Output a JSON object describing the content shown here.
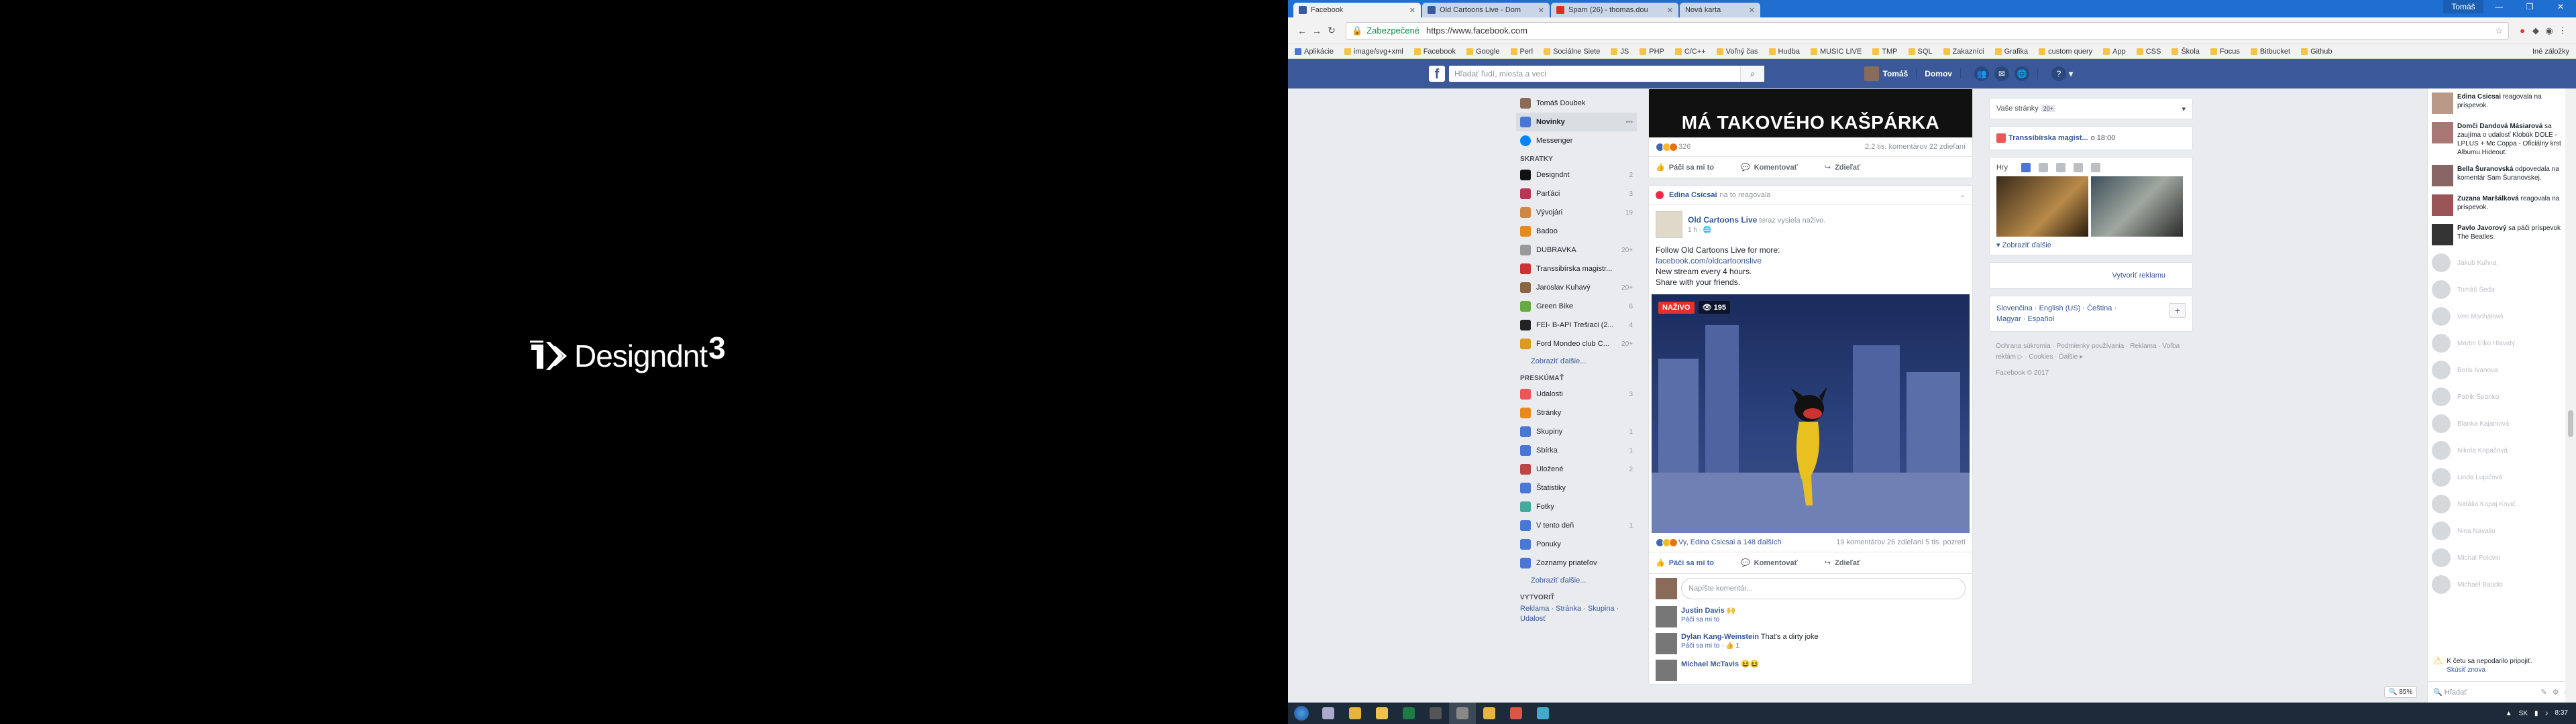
{
  "logo": {
    "brand": "Designdnt",
    "suffix": "3"
  },
  "browser": {
    "tabs": [
      {
        "title": "Facebook",
        "color": "#3b5998",
        "active": true
      },
      {
        "title": "Old Cartoons Live - Dom",
        "color": "#3b5998",
        "active": false
      },
      {
        "title": "Spam (26) - thomas.dou",
        "color": "#d93025",
        "active": false
      },
      {
        "title": "Nová karta",
        "color": "#cccccc",
        "active": false
      }
    ],
    "window_controls": [
      "Tomáš",
      "—",
      "❐",
      "✕"
    ],
    "secure_label": "Zabezpečené",
    "url": "https://www.facebook.com",
    "bookmarks": [
      "Aplikácie",
      "image/svg+xml",
      "Facebook",
      "Google",
      "Perl",
      "Sociálne Siete",
      "JS",
      "PHP",
      "C/C++",
      "Voľný čas",
      "Hudba",
      "MUSIC LIVE",
      "TMP",
      "SQL",
      "Zakazníci",
      "Grafika",
      "custom query",
      "App",
      "CSS",
      "Škola",
      "Focus",
      "Bitbucket",
      "Github"
    ],
    "other_bookmarks": "Iné záložky"
  },
  "fb": {
    "search_placeholder": "Hľadať ľudí, miesta a veci",
    "user": "Tomáš",
    "home": "Domov",
    "nav": {
      "profile": "Tomáš Doubek",
      "primary": [
        {
          "label": "Novinky",
          "active": true
        },
        {
          "label": "Messenger"
        }
      ],
      "shortcuts_header": "SKRATKY",
      "shortcuts": [
        {
          "label": "Designdnt",
          "count": "2",
          "color": "#111"
        },
        {
          "label": "Parťáci",
          "count": "3",
          "color": "#b35"
        },
        {
          "label": "Vývojári",
          "count": "19",
          "color": "#c84"
        },
        {
          "label": "Badoo",
          "count": "",
          "color": "#e8891e"
        },
        {
          "label": "DUBRAVKA",
          "count": "20+",
          "color": "#999"
        },
        {
          "label": "Transsibírska magistr...",
          "count": "",
          "color": "#c33"
        },
        {
          "label": "Jaroslav Kuhavý",
          "count": "20+",
          "color": "#864"
        },
        {
          "label": "Green Bike",
          "count": "6",
          "color": "#6a4"
        },
        {
          "label": "FEI- B-API Trešiaci (2...",
          "count": "4",
          "color": "#222"
        },
        {
          "label": "Ford Mondeo club C...",
          "count": "20+",
          "color": "#d92"
        }
      ],
      "show_more": "Zobraziť ďalšie...",
      "explore_header": "PRESKÚMAŤ",
      "explore": [
        {
          "label": "Udalosti",
          "count": "3",
          "color": "#e55"
        },
        {
          "label": "Stránky",
          "count": "",
          "color": "#e8891e"
        },
        {
          "label": "Skupiny",
          "count": "1",
          "color": "#4a76d4"
        },
        {
          "label": "Sbírka",
          "count": "1",
          "color": "#4a76d4"
        },
        {
          "label": "Uložené",
          "count": "2",
          "color": "#b44"
        },
        {
          "label": "Štatistiky",
          "count": "",
          "color": "#4a76d4"
        },
        {
          "label": "Fotky",
          "count": "",
          "color": "#4a9"
        },
        {
          "label": "V tento deň",
          "count": "1",
          "color": "#4a76d4"
        },
        {
          "label": "Ponuky",
          "count": "",
          "color": "#4a76d4"
        },
        {
          "label": "Zoznamy priateľov",
          "count": "",
          "color": "#4a76d4"
        }
      ],
      "show_more2": "Zobraziť ďalšie...",
      "create_header": "VYTVORIŤ",
      "create_links": "Reklama · Stránka · Skupina · Udalosť"
    },
    "post1": {
      "banner": "MÁ TAKOVÉHO KAŠPÁRKA",
      "reactions": "326",
      "comments_shares": "2,2 tis. komentárov  22 zdieľaní",
      "actions": [
        "Páči sa mi to",
        "Komentovať",
        "Zdieľať"
      ]
    },
    "post2": {
      "notice_name": "Edina Csicsai",
      "notice_text": "na to reagovala",
      "page": "Old Cartoons Live",
      "page_sub": "teraz vysiela naživo.",
      "time": "1 h · 🌐",
      "lines": [
        "Follow Old Cartoons Live for more:",
        "facebook.com/oldcartoonslive",
        "New stream every 4 hours.",
        "Share with your friends."
      ],
      "live_label": "NAŽIVO",
      "viewers": "195",
      "reactions": "Vy, Edina Csicsai a 148 ďalších",
      "comments_shares": "19 komentárov  26 zdieľaní  5 tis. pozretí",
      "actions": [
        "Páči sa mi to",
        "Komentovať",
        "Zdieľať"
      ],
      "comment_placeholder": "Napíšte komentár...",
      "comments": [
        {
          "name": "Justin Davis",
          "text": "🙌",
          "meta": "Páči sa mi to"
        },
        {
          "name": "Dylan Kang-Weinstein",
          "text": "That's a dirty joke",
          "meta": "Páči sa mi to · 👍 1"
        },
        {
          "name": "Michael McTavis",
          "text": "😆😆",
          "meta": ""
        }
      ]
    },
    "right": {
      "pages_select": "Vaše stránky",
      "pages_badge": "20+",
      "event_name": "Transsibírska magist...",
      "event_time": "o 18:00",
      "games_title": "Hry",
      "games_more": "Zobraziť ďalšie",
      "ads": "Vytvoriť reklamu",
      "languages": "Slovenčina · English (US) · Čeština · Magyar · Español",
      "footer1": "Ochrana súkromia · Podmienky používania · Reklama · Voľba reklám ▷ · Cookies · Ďalšie ▸",
      "footer2": "Facebook © 2017"
    },
    "chat": {
      "notifications": [
        {
          "name": "Edina Csicsai",
          "text": "reagovala na príspevok.",
          "color": "#b98"
        },
        {
          "name": "Domči Dandová Másiarová",
          "text": "sa zaujíma o udalosť Klobúk DOLE - LPLUS + Mc Coppa - Oficiálny krst Albumu Hideout.",
          "color": "#a77"
        },
        {
          "name": "Bella Šuranovská",
          "text": "odpovedala na komentár Sam Šuranovskej.",
          "color": "#866"
        },
        {
          "name": "Zuzana Maršálková",
          "text": "reagovala na príspevok.",
          "color": "#955"
        },
        {
          "name": "Pavlo Javorový",
          "text": "sa páči príspevok The Beatles.",
          "color": "#333"
        }
      ],
      "contacts": [
        "Jakub Kuhna",
        "Tomáš Šeda",
        "Veri Machálová",
        "Martin Elko Hlavatý",
        "Boris Ivanova",
        "Patrik Španko",
        "Blanka Kajaniová",
        "Nikola Kopačová",
        "Linda Lupičová",
        "Natália Kopaj Kovič",
        "Nina Navalio",
        "Michal Polovin",
        "Michael Baudis"
      ],
      "offline_text": "K četu sa nepodarilo pripojiť.",
      "offline_retry": "Skúsiť znova",
      "search_placeholder": "Hľadať"
    },
    "zoom": "85%"
  },
  "taskbar": {
    "icons": [
      {
        "name": "search-icon",
        "color": "#aac"
      },
      {
        "name": "files-icon",
        "color": "#e8b43a"
      },
      {
        "name": "explorer-icon",
        "color": "#f0c14b"
      },
      {
        "name": "excel-icon",
        "color": "#1e7b45"
      },
      {
        "name": "terminal-icon",
        "color": "#555"
      },
      {
        "name": "app-icon",
        "color": "#888"
      },
      {
        "name": "folder-icon",
        "color": "#e8b43a"
      },
      {
        "name": "chrome-icon",
        "color": "#d54"
      },
      {
        "name": "ps-icon",
        "color": "#4ac"
      }
    ],
    "lang": "SK",
    "time": "8:37"
  }
}
